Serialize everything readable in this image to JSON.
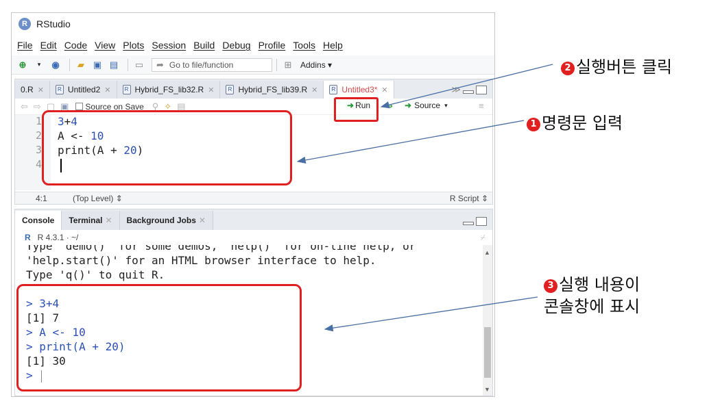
{
  "window": {
    "title": "RStudio",
    "logo": "R"
  },
  "menu": [
    "File",
    "Edit",
    "Code",
    "View",
    "Plots",
    "Session",
    "Build",
    "Debug",
    "Profile",
    "Tools",
    "Help"
  ],
  "toolbar": {
    "goto_placeholder": "Go to file/function",
    "addins": "Addins"
  },
  "editor_tabs": [
    {
      "label": "0.R",
      "active": false
    },
    {
      "label": "Untitled2",
      "active": false
    },
    {
      "label": "Hybrid_FS_lib32.R",
      "active": false
    },
    {
      "label": "Hybrid_FS_lib39.R",
      "active": false
    },
    {
      "label": "Untitled3*",
      "active": true
    }
  ],
  "editor_toolbar": {
    "source_on_save": "Source on Save",
    "run": "Run",
    "source": "Source"
  },
  "code_lines": [
    {
      "n": "1",
      "text": "3+4"
    },
    {
      "n": "2",
      "text": "A <- 10"
    },
    {
      "n": "3",
      "text": "print(A + 20)"
    },
    {
      "n": "4",
      "text": ""
    }
  ],
  "status": {
    "position": "4:1",
    "level": "(Top Level)",
    "file_type": "R Script"
  },
  "console_tabs": [
    {
      "label": "Console",
      "active": true
    },
    {
      "label": "Terminal",
      "active": false
    },
    {
      "label": "Background Jobs",
      "active": false
    }
  ],
  "console_info": "R 4.3.1 · ~/",
  "console_lines": [
    {
      "text": "Type 'demo()' for some demos, 'help()' for on-line help, or",
      "kind": "out"
    },
    {
      "text": "'help.start()' for an HTML browser interface to help.",
      "kind": "out"
    },
    {
      "text": "Type 'q()' to quit R.",
      "kind": "out"
    },
    {
      "text": "",
      "kind": "out"
    },
    {
      "text": "> 3+4",
      "kind": "cmd"
    },
    {
      "text": "[1] 7",
      "kind": "out"
    },
    {
      "text": "> A <- 10",
      "kind": "cmd"
    },
    {
      "text": "> print(A + 20)",
      "kind": "cmd"
    },
    {
      "text": "[1] 30",
      "kind": "out"
    },
    {
      "text": ">",
      "kind": "cmd"
    }
  ],
  "annotations": {
    "step1": {
      "num": "1",
      "text": "명령문 입력"
    },
    "step2": {
      "num": "2",
      "text": "실행버튼 클릭"
    },
    "step3": {
      "num": "3",
      "line1": "실행 내용이",
      "line2": "콘솔창에 표시"
    }
  },
  "colors": {
    "highlight": "#e02020",
    "arrow": "#4a6fa5",
    "code_number": "#2b4fb5"
  }
}
